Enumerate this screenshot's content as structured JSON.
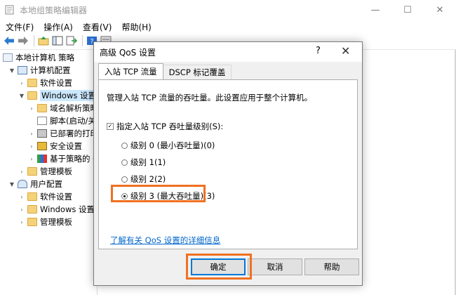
{
  "window": {
    "title": "本地组策略编辑器",
    "controls": {
      "minimize": "—",
      "maximize": "☐",
      "close": "✕"
    }
  },
  "menu": [
    "文件(F)",
    "操作(A)",
    "查看(V)",
    "帮助(H)"
  ],
  "toolbar_icons": [
    "back-arrow-icon",
    "forward-arrow-icon",
    "up-folder-icon",
    "show-hide-tree-icon",
    "export-list-icon",
    "help-icon",
    "properties-icon"
  ],
  "tree": {
    "root": "本地计算机 策略",
    "computer_config": "计算机配置",
    "software_settings": "软件设置",
    "windows_settings": "Windows 设置",
    "dns_policy": "域名解析策略",
    "scripts": "脚本(启动/关",
    "deployed_printers": "已部署的打印",
    "security_settings": "安全设置",
    "policy_qos": "基于策略的 C",
    "admin_templates": "管理模板",
    "user_config": "用户配置",
    "user_software": "软件设置",
    "user_windows": "Windows 设置",
    "user_admin": "管理模板"
  },
  "dialog": {
    "title": "高级 QoS 设置",
    "help_glyph": "?",
    "close_glyph": "✕",
    "tabs": [
      "入站 TCP 流量",
      "DSCP 标记覆盖"
    ],
    "description": "管理入站 TCP 流量的吞吐量。此设置应用于整个计算机。",
    "checkbox_label": "指定入站 TCP 吞吐量级别(S):",
    "checkbox_checked": true,
    "levels": [
      "级别 0 (最小吞吐量)(0)",
      "级别 1(1)",
      "级别 2(2)",
      "级别 3 (最大吞吐量)(3)"
    ],
    "selected_level": 3,
    "link": "了解有关 QoS 设置的详细信息",
    "buttons": {
      "ok": "确定",
      "cancel": "取消",
      "help": "帮助"
    }
  },
  "colors": {
    "highlight": "#f07022",
    "accent": "#0078d7",
    "link": "#0066cc",
    "selection": "#cce8ff"
  }
}
